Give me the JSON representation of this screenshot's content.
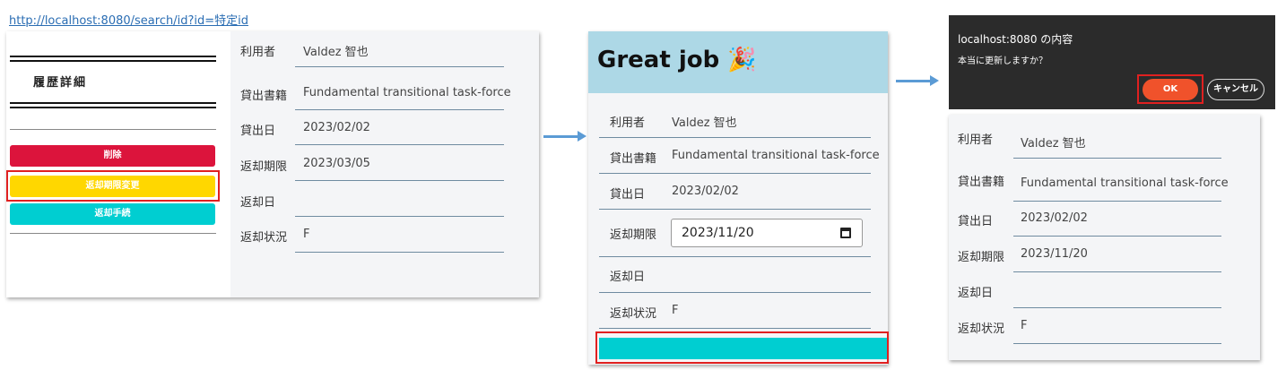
{
  "url": "http://localhost:8080/search/id?id=特定id",
  "panel1": {
    "title": "履歴詳細",
    "buttons": {
      "delete": "削除",
      "change_due": "返却期限変更",
      "return": "返却手続"
    },
    "rows": [
      {
        "label": "利用者",
        "value": "Valdez 智也"
      },
      {
        "label": "貸出書籍",
        "value": "Fundamental transitional task-force"
      },
      {
        "label": "貸出日",
        "value": "2023/02/02"
      },
      {
        "label": "返却期限",
        "value": "2023/03/05"
      },
      {
        "label": "返却日",
        "value": ""
      },
      {
        "label": "返却状況",
        "value": "F"
      }
    ]
  },
  "panel2": {
    "title": "Great job 🎉",
    "rows": [
      {
        "label": "利用者",
        "value": "Valdez 智也"
      },
      {
        "label": "貸出書籍",
        "value": "Fundamental transitional task-force"
      },
      {
        "label": "貸出日",
        "value": "2023/02/02"
      },
      {
        "label": "返却期限",
        "value": "2023/11/20"
      },
      {
        "label": "返却日",
        "value": ""
      },
      {
        "label": "返却状況",
        "value": "F"
      }
    ]
  },
  "dialog": {
    "title": "localhost:8080 の内容",
    "message": "本当に更新しますか？",
    "ok": "OK",
    "cancel": "キャンセル"
  },
  "panel3": {
    "rows": [
      {
        "label": "利用者",
        "value": "Valdez 智也"
      },
      {
        "label": "貸出書籍",
        "value": "Fundamental transitional task-force"
      },
      {
        "label": "貸出日",
        "value": "2023/02/02"
      },
      {
        "label": "返却期限",
        "value": "2023/11/20"
      },
      {
        "label": "返却日",
        "value": ""
      },
      {
        "label": "返却状況",
        "value": "F"
      }
    ]
  },
  "colors": {
    "delete": "#dc143c",
    "change_due": "#ffd700",
    "return": "#00ced1",
    "header_bg": "#add8e6",
    "ok": "#f0522b",
    "highlight": "#e02020",
    "arrow": "#5b9bd5"
  }
}
